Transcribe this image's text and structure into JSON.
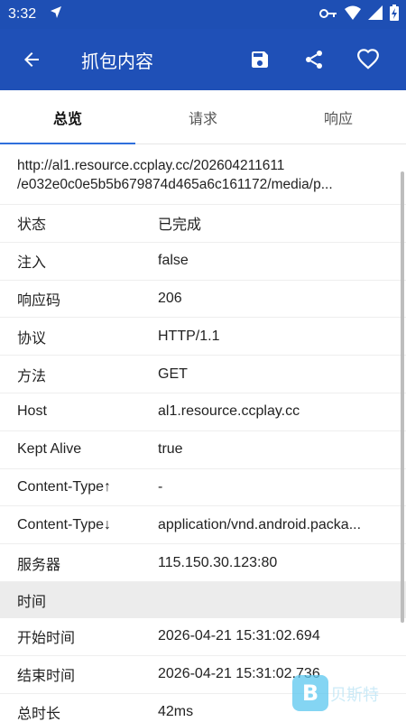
{
  "status_bar": {
    "time": "3:32"
  },
  "app_bar": {
    "title": "抓包内容"
  },
  "tabs": [
    {
      "label": "总览",
      "active": true
    },
    {
      "label": "请求",
      "active": false
    },
    {
      "label": "响应",
      "active": false
    }
  ],
  "url": {
    "line1": "http://al1.resource.ccplay.cc/202604211611",
    "line2": "/e032e0c0e5b5b679874d465a6c161172/media/p..."
  },
  "rows": [
    {
      "key": "状态",
      "value": "已完成"
    },
    {
      "key": "注入",
      "value": "false"
    },
    {
      "key": "响应码",
      "value": "206"
    },
    {
      "key": "协议",
      "value": "HTTP/1.1"
    },
    {
      "key": "方法",
      "value": "GET"
    },
    {
      "key": "Host",
      "value": "al1.resource.ccplay.cc"
    },
    {
      "key": "Kept Alive",
      "value": "true"
    },
    {
      "key": "Content-Type↑",
      "value": "-"
    },
    {
      "key": "Content-Type↓",
      "value": "application/vnd.android.packa..."
    },
    {
      "key": "服务器",
      "value": "115.150.30.123:80"
    }
  ],
  "time_section": {
    "title": "时间",
    "rows": [
      {
        "key": "开始时间",
        "value": "2026-04-21 15:31:02.694"
      },
      {
        "key": "结束时间",
        "value": "2026-04-21 15:31:02.736"
      },
      {
        "key": "总时长",
        "value": "42ms"
      }
    ]
  },
  "watermark": {
    "logo_text": "B",
    "text": "贝斯特"
  },
  "colors": {
    "primary": "#1f50b7",
    "accent": "#2f6fdc",
    "section_bg": "#ececec"
  },
  "icons": [
    "navigation-arrow-icon",
    "key-icon",
    "wifi-icon",
    "signal-icon",
    "battery-icon",
    "back-arrow-icon",
    "save-icon",
    "share-icon",
    "heart-icon"
  ]
}
